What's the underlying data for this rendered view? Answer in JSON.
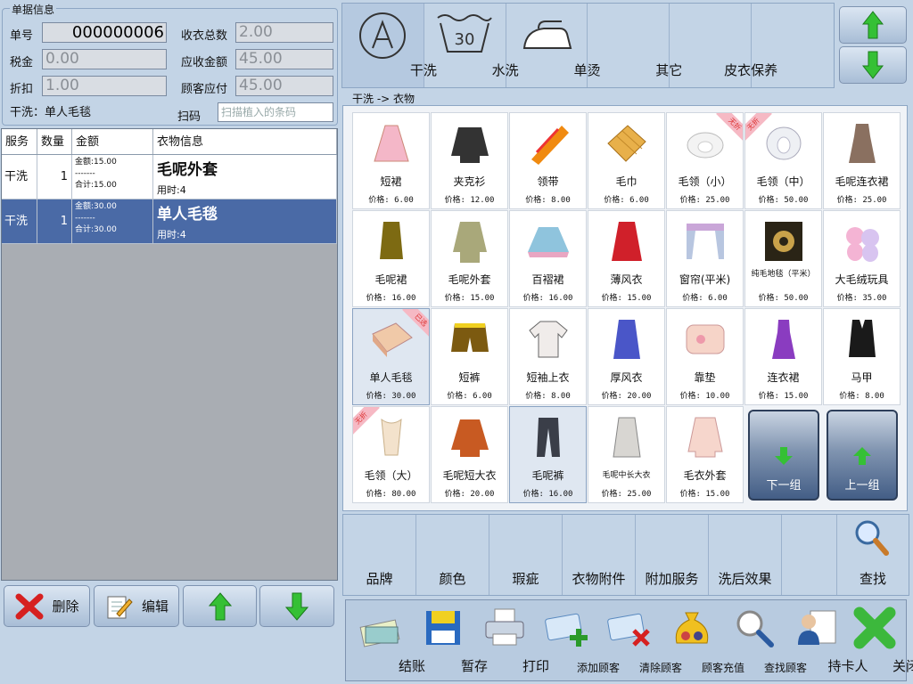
{
  "order": {
    "legend": "单据信息",
    "order_no_label": "单号",
    "order_no": "000000006",
    "total_pieces_label": "收衣总数",
    "total_pieces": "2.00",
    "tax_label": "税金",
    "tax": "0.00",
    "receivable_label": "应收金额",
    "receivable": "45.00",
    "discount_label": "折扣",
    "discount": "1.00",
    "customer_pay_label": "顾客应付",
    "customer_pay": "45.00",
    "current_item": "干洗：单人毛毯",
    "scan_label": "扫码",
    "scan_placeholder": "扫描植入的条码"
  },
  "table": {
    "headers": [
      "服务",
      "数量",
      "金额",
      "衣物信息"
    ],
    "rows": [
      {
        "service": "干洗",
        "qty": "1",
        "amount": "金额:15.00",
        "sep": "-------",
        "total": "合计:15.00",
        "name": "毛呢外套",
        "time": "用时:4"
      },
      {
        "service": "干洗",
        "qty": "1",
        "amount": "金额:30.00",
        "sep": "-------",
        "total": "合计:30.00",
        "name": "单人毛毯",
        "time": "用时:4"
      }
    ]
  },
  "left_buttons": {
    "delete": "删除",
    "edit": "编辑"
  },
  "service_tabs": [
    "干洗",
    "水洗",
    "单烫",
    "其它",
    "皮衣保养"
  ],
  "wash_icon_number": "30",
  "breadcrumb": "干洗 -> 衣物",
  "ribbons": {
    "discount": "无折",
    "used": "已选"
  },
  "items": [
    {
      "name": "短裙",
      "price": "价格: 6.00"
    },
    {
      "name": "夹克衫",
      "price": "价格: 12.00"
    },
    {
      "name": "领带",
      "price": "价格: 8.00"
    },
    {
      "name": "毛巾",
      "price": "价格: 6.00"
    },
    {
      "name": "毛领（小）",
      "price": "价格: 25.00"
    },
    {
      "name": "毛领（中）",
      "price": "价格: 50.00"
    },
    {
      "name": "毛呢连衣裙",
      "price": "价格: 25.00"
    },
    {
      "name": "毛呢裙",
      "price": "价格: 16.00"
    },
    {
      "name": "毛呢外套",
      "price": "价格: 15.00"
    },
    {
      "name": "百褶裙",
      "price": "价格: 16.00"
    },
    {
      "name": "薄风衣",
      "price": "价格: 15.00"
    },
    {
      "name": "窗帘(平米)",
      "price": "价格: 6.00"
    },
    {
      "name": "纯毛地毯（平米）",
      "price": "价格: 50.00"
    },
    {
      "name": "大毛绒玩具",
      "price": "价格: 35.00"
    },
    {
      "name": "单人毛毯",
      "price": "价格: 30.00"
    },
    {
      "name": "短裤",
      "price": "价格: 6.00"
    },
    {
      "name": "短袖上衣",
      "price": "价格: 8.00"
    },
    {
      "name": "厚风衣",
      "price": "价格: 20.00"
    },
    {
      "name": "靠垫",
      "price": "价格: 10.00"
    },
    {
      "name": "连衣裙",
      "price": "价格: 15.00"
    },
    {
      "name": "马甲",
      "price": "价格: 8.00"
    },
    {
      "name": "毛领（大）",
      "price": "价格: 80.00"
    },
    {
      "name": "毛呢短大衣",
      "price": "价格: 20.00"
    },
    {
      "name": "毛呢裤",
      "price": "价格: 16.00"
    },
    {
      "name": "毛呢中长大衣",
      "price": "价格: 25.00"
    },
    {
      "name": "毛衣外套",
      "price": "价格: 15.00"
    }
  ],
  "page_buttons": {
    "next": "下一组",
    "prev": "上一组"
  },
  "attributes": [
    "品牌",
    "颜色",
    "瑕疵",
    "衣物附件",
    "附加服务",
    "洗后效果",
    "",
    "查找"
  ],
  "toolbar": [
    "结账",
    "暂存",
    "打印",
    "添加顾客",
    "清除顾客",
    "顾客充值",
    "查找顾客",
    "持卡人",
    "关闭"
  ],
  "colors": {
    "background": "#c3d4e6",
    "selected_row": "#4a6aa6",
    "arrow_green": "#2fbf2f",
    "close_green": "#3cb83c"
  }
}
